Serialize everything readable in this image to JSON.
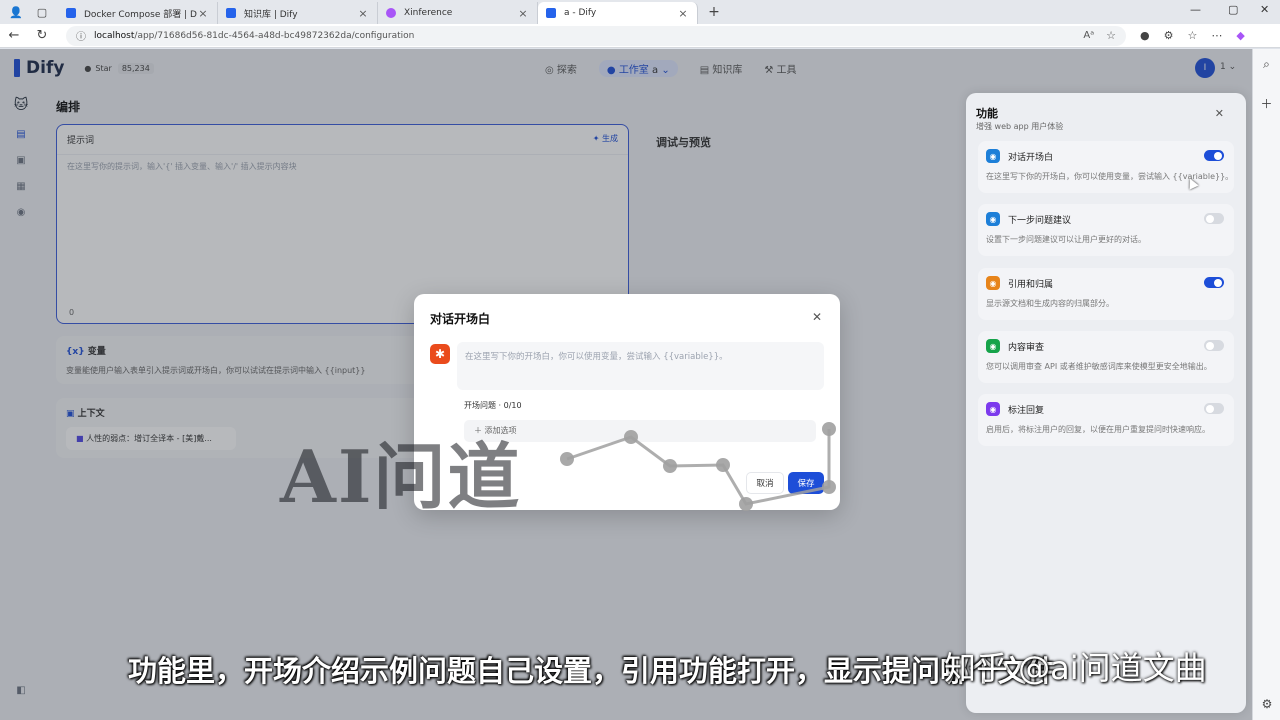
{
  "browser": {
    "tabs": [
      {
        "title": "Docker Compose 部署 | Dify",
        "active": false,
        "icon": "dify-icon"
      },
      {
        "title": "知识库 | Dify",
        "active": false,
        "icon": "dify-icon"
      },
      {
        "title": "Xinference",
        "active": false,
        "icon": "xinference-icon"
      },
      {
        "title": "a - Dify",
        "active": true,
        "icon": "dify-icon"
      }
    ],
    "new_tab": "+",
    "url_host": "localhost",
    "url_path": "/app/71686d56-81dc-4564-a48d-bc49872362da/configuration"
  },
  "app": {
    "logo": "Dify",
    "github_label": "Star",
    "github_count": "85,234",
    "nav": [
      {
        "label": "探索",
        "icon": "explore-icon"
      },
      {
        "label": "工作室",
        "icon": "studio-icon",
        "active": true,
        "suffix": "a"
      },
      {
        "label": "知识库",
        "icon": "knowledge-icon"
      },
      {
        "label": "工具",
        "icon": "tools-icon"
      }
    ],
    "avatar": "I",
    "avatar_suffix": "1"
  },
  "editor": {
    "title": "编排",
    "prompt_label": "提示词",
    "generate": "生成",
    "prompt_placeholder": "在这里写你的提示词，输入'{' 插入变量、输入'/' 插入提示内容块",
    "prompt_count": "0",
    "variables_label": "变量",
    "variables_desc": "变量能使用户输入表单引入提示词或开场白，你可以试试在提示词中输入 {{input}}",
    "context_label": "上下文",
    "context_item": "人性的弱点：增订全译本 - [美]戴...",
    "debug_title": "调试与预览"
  },
  "panel": {
    "title": "功能",
    "subtitle": "增强 web app 用户体验",
    "features": [
      {
        "name": "对话开场白",
        "desc": "在这里写下你的开场白，你可以使用变量，尝试输入 {{variable}}。",
        "on": true,
        "color": "#1d7fd8"
      },
      {
        "name": "下一步问题建议",
        "desc": "设置下一步问题建议可以让用户更好的对话。",
        "on": false,
        "color": "#1d7fd8"
      },
      {
        "name": "引用和归属",
        "desc": "显示源文档和生成内容的归属部分。",
        "on": true,
        "color": "#e7841a"
      },
      {
        "name": "内容审查",
        "desc": "您可以调用审查 API 或者维护敏感词库来使模型更安全地输出。",
        "on": false,
        "color": "#16a34a"
      },
      {
        "name": "标注回复",
        "desc": "启用后，将标注用户的回复，以便在用户重复提问时快速响应。",
        "on": false,
        "color": "#7c3aed"
      }
    ]
  },
  "modal": {
    "title": "对话开场白",
    "placeholder": "在这里写下你的开场白，你可以使用变量，尝试输入 {{variable}}。",
    "questions_label": "开场问题 · 0/10",
    "add_option": "添加选项",
    "cancel": "取消",
    "save": "保存"
  },
  "overlay": {
    "watermark": "AI问道",
    "caption": "功能里，开场介绍示例问题自己设置，引用功能打开，显示提问哪个文件",
    "zhihu_mark": "知乎 @ai问道文曲"
  }
}
